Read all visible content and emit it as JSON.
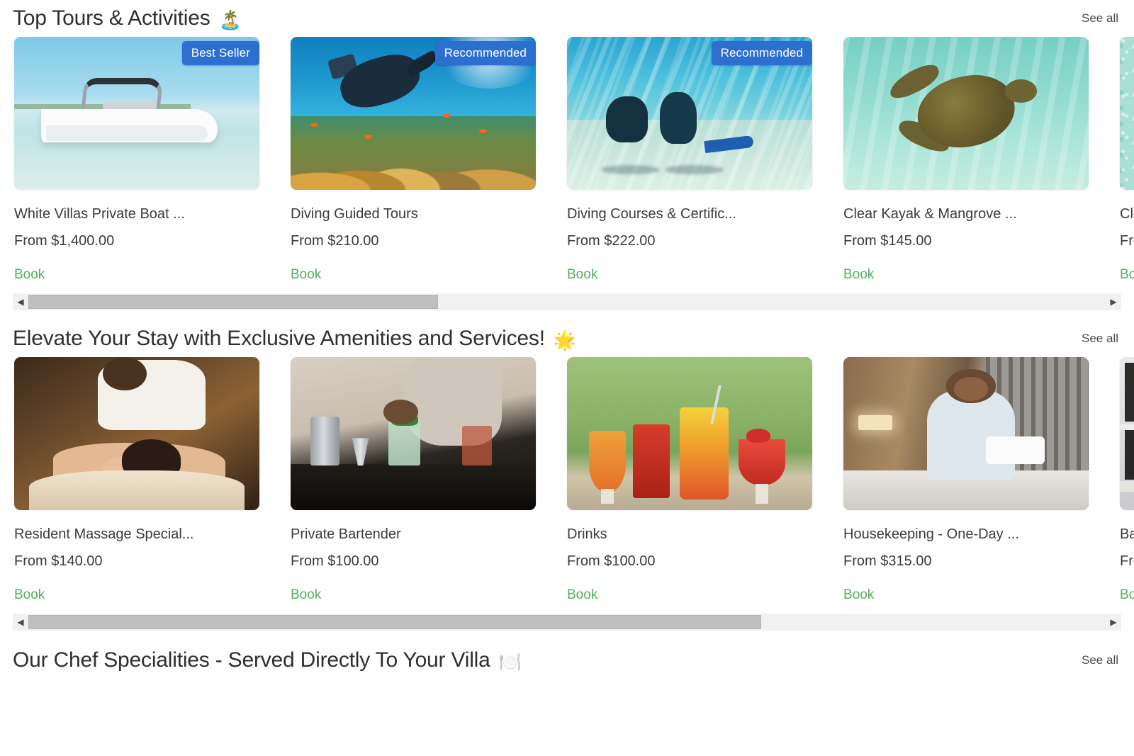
{
  "sections": [
    {
      "title": "Top Tours & Activities",
      "emoji": "🏝️",
      "see_all": "See all",
      "scrollbar": {
        "left_arrow": "◀",
        "right_arrow": "▶",
        "thumb_percent": 38
      },
      "cards": [
        {
          "title": "White Villas Private Boat ...",
          "price": "From $1,400.00",
          "book": "Book",
          "badge": "Best Seller",
          "art": "art-boat"
        },
        {
          "title": "Diving Guided Tours",
          "price": "From $210.00",
          "book": "Book",
          "badge": "Recommended",
          "art": "art-reef"
        },
        {
          "title": "Diving Courses & Certific...",
          "price": "From $222.00",
          "book": "Book",
          "badge": "Recommended",
          "art": "art-course"
        },
        {
          "title": "Clear Kayak & Mangrove ...",
          "price": "From $145.00",
          "book": "Book",
          "badge": "",
          "art": "art-turtle"
        },
        {
          "title": "Clear K",
          "price": "From $",
          "book": "Book",
          "badge": "",
          "art": "art-sand"
        }
      ]
    },
    {
      "title": "Elevate Your Stay with Exclusive Amenities and Services!",
      "emoji": "🌟",
      "see_all": "See all",
      "scrollbar": {
        "left_arrow": "◀",
        "right_arrow": "▶",
        "thumb_percent": 68
      },
      "cards": [
        {
          "title": "Resident Massage Special...",
          "price": "From $140.00",
          "book": "Book",
          "badge": "",
          "art": "art-massage"
        },
        {
          "title": "Private Bartender",
          "price": "From $100.00",
          "book": "Book",
          "badge": "",
          "art": "art-bar"
        },
        {
          "title": "Drinks",
          "price": "From $100.00",
          "book": "Book",
          "badge": "",
          "art": "art-drinks"
        },
        {
          "title": "Housekeeping - One-Day ...",
          "price": "From $315.00",
          "book": "Book",
          "badge": "",
          "art": "art-house"
        },
        {
          "title": "Baby s",
          "price": "From $",
          "book": "Book",
          "badge": "",
          "art": "art-window"
        }
      ]
    },
    {
      "title": "Our Chef Specialities - Served Directly To Your Villa",
      "emoji": "🍽️",
      "see_all": "See all",
      "scrollbar": null,
      "cards": []
    }
  ],
  "colors": {
    "badge_blue": "#2d6fd1",
    "book_green": "#52b257",
    "title_text": "#2f2f2f",
    "body_text": "#3b3b3b",
    "scrollbar_track": "#f1f1f1",
    "scrollbar_thumb": "#bfbfbf"
  }
}
